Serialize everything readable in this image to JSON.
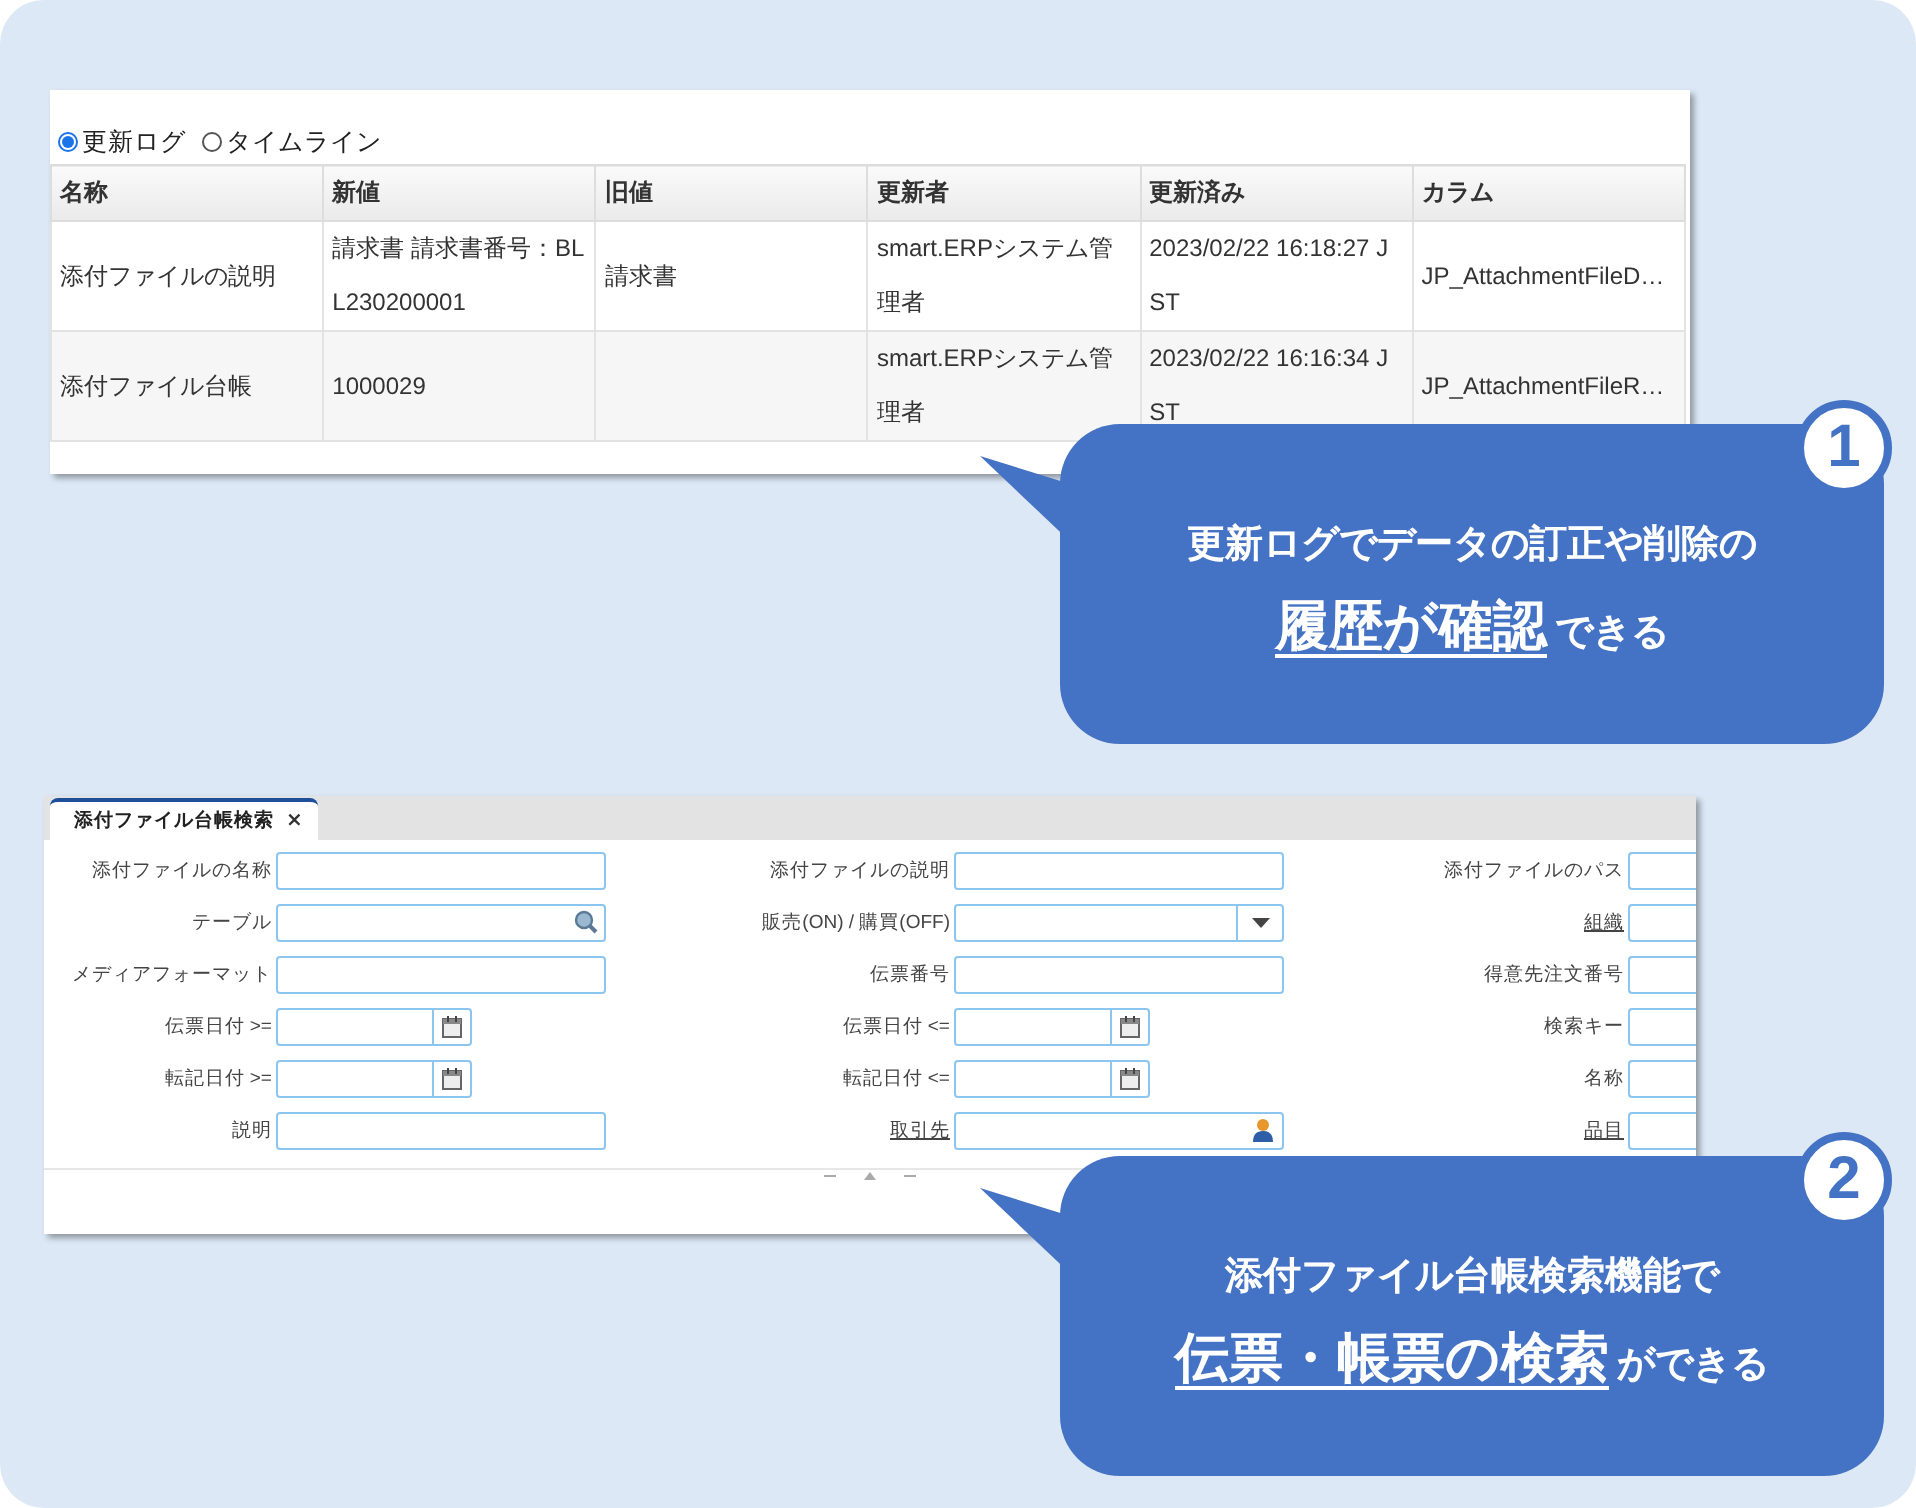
{
  "update_log": {
    "view_options": [
      {
        "label": "更新ログ",
        "selected": true
      },
      {
        "label": "タイムライン",
        "selected": false
      }
    ],
    "table": {
      "columns": [
        "名称",
        "新値",
        "旧値",
        "更新者",
        "更新済み",
        "カラム"
      ],
      "rows": [
        [
          "添付ファイルの説明",
          "請求書 請求書番号：BLL230200001",
          "請求書",
          "smart.ERPシステム管理者",
          "2023/02/22 16:18:27 JST",
          "JP_AttachmentFileD…"
        ],
        [
          "添付ファイル台帳",
          "1000029",
          "",
          "smart.ERPシステム管理者",
          "2023/02/22 16:16:34 JST",
          "JP_AttachmentFileR…"
        ]
      ]
    }
  },
  "search_form": {
    "tab": {
      "label": "添付ファイル台帳検索",
      "close": "×"
    },
    "fields": [
      {
        "label": "添付ファイルの名称",
        "kind": "text",
        "link": false
      },
      {
        "label": "添付ファイルの説明",
        "kind": "text",
        "link": false
      },
      {
        "label": "添付ファイルのパス",
        "kind": "cut",
        "link": false
      },
      {
        "label": "テーブル",
        "kind": "search",
        "link": false
      },
      {
        "label": "販売(ON) / 購買(OFF)",
        "kind": "select",
        "link": false
      },
      {
        "label": "組織",
        "kind": "cut",
        "link": true
      },
      {
        "label": "メディアフォーマット",
        "kind": "text",
        "link": false
      },
      {
        "label": "伝票番号",
        "kind": "text",
        "link": false
      },
      {
        "label": "得意先注文番号",
        "kind": "cut",
        "link": false
      },
      {
        "label": "伝票日付 >=",
        "kind": "date",
        "link": false
      },
      {
        "label": "伝票日付 <=",
        "kind": "date",
        "link": false
      },
      {
        "label": "検索キー",
        "kind": "cut",
        "link": false
      },
      {
        "label": "転記日付 >=",
        "kind": "date",
        "link": false
      },
      {
        "label": "転記日付 <=",
        "kind": "date",
        "link": false
      },
      {
        "label": "名称",
        "kind": "cut",
        "link": false
      },
      {
        "label": "説明",
        "kind": "text",
        "link": false
      },
      {
        "label": "取引先",
        "kind": "person",
        "link": true
      },
      {
        "label": "品目",
        "kind": "cut",
        "link": true
      }
    ]
  },
  "callouts": [
    {
      "number": "1",
      "line1": "更新ログでデータの訂正や削除の",
      "emphasis": "履歴が確認",
      "rest": "できる"
    },
    {
      "number": "2",
      "line1": "添付ファイル台帳検索機能で",
      "emphasis": "伝票・帳票の検索",
      "rest": "ができる"
    }
  ]
}
